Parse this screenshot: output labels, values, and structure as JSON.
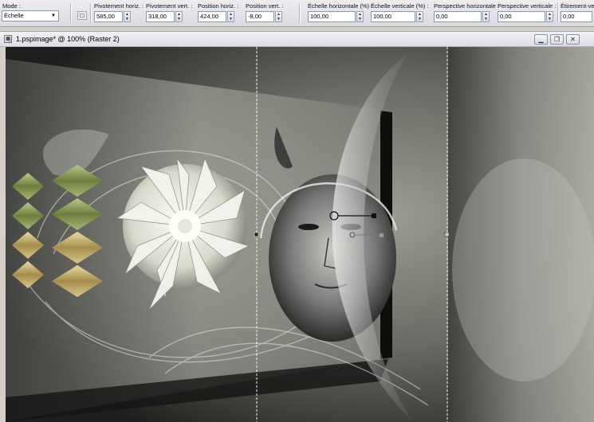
{
  "toolbar": {
    "mode_label": "Mode :",
    "mode_value": "Échelle",
    "fields": [
      {
        "label": "Pivotement horiz. :",
        "value": "585,00"
      },
      {
        "label": "Pivotement vert. :",
        "value": "318,00"
      },
      {
        "label": "Position horiz. :",
        "value": "424,00"
      },
      {
        "label": "Position vert. :",
        "value": "-8,00"
      },
      {
        "label": "Échelle horizontale (%) :",
        "value": "100,00"
      },
      {
        "label": "Échelle verticale (%) :",
        "value": "100,00"
      },
      {
        "label": "Perspective horizontale :",
        "value": "0,00"
      },
      {
        "label": "Perspective verticale :",
        "value": "0,00"
      },
      {
        "label": "Étirement-vert",
        "value": "0,00"
      }
    ]
  },
  "document": {
    "title": "1.pspimage* @ 100% (Raster 2)",
    "buttons": {
      "minimize": "▁",
      "restore": "❐",
      "close": "✕"
    }
  },
  "colors": {
    "input_border": "#7f9db9",
    "canvas_dark": "#2e2e2c",
    "diamond_green": "#8a9a52",
    "diamond_gold": "#c7b274"
  },
  "icons": [
    "document-icon",
    "reset-icon",
    "dropdown-arrow-icon",
    "spin-up-icon",
    "spin-down-icon",
    "pivot-handle-icon"
  ]
}
